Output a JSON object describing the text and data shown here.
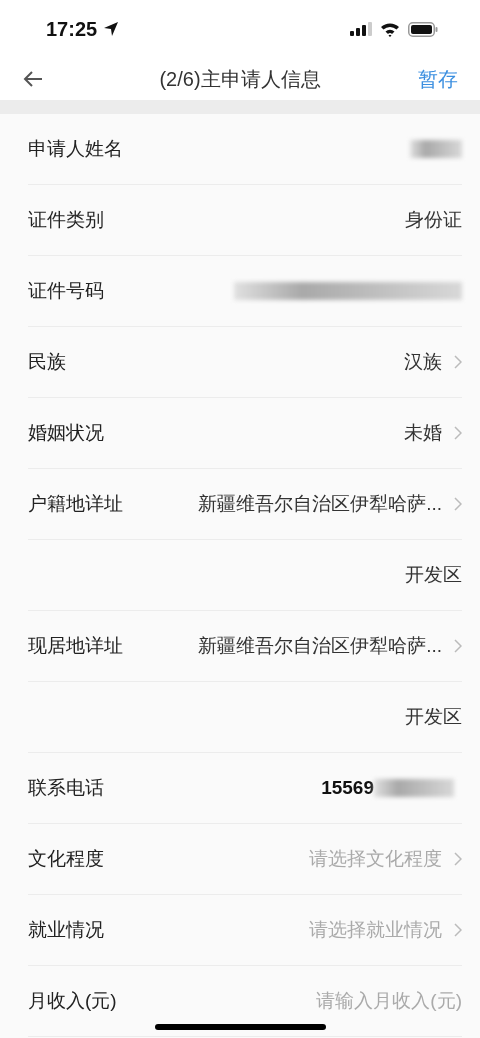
{
  "status_bar": {
    "time": "17:25"
  },
  "nav": {
    "title": "(2/6)主申请人信息",
    "action": "暂存"
  },
  "rows": [
    {
      "kind": "redacted",
      "label": "申请人姓名"
    },
    {
      "kind": "text",
      "label": "证件类别",
      "value": "身份证"
    },
    {
      "kind": "redacted_wide",
      "label": "证件号码"
    },
    {
      "kind": "select",
      "label": "民族",
      "value": "汉族"
    },
    {
      "kind": "select",
      "label": "婚姻状况",
      "value": "未婚"
    },
    {
      "kind": "select",
      "label": "户籍地详址",
      "value": "新疆维吾尔自治区伊犁哈萨..."
    },
    {
      "kind": "text",
      "value": "开发区"
    },
    {
      "kind": "select",
      "label": "现居地详址",
      "value": "新疆维吾尔自治区伊犁哈萨..."
    },
    {
      "kind": "text",
      "value": "开发区"
    },
    {
      "kind": "partial",
      "label": "联系电话",
      "value": "15569"
    },
    {
      "kind": "select",
      "label": "文化程度",
      "placeholder": "请选择文化程度"
    },
    {
      "kind": "select",
      "label": "就业情况",
      "placeholder": "请选择就业情况"
    },
    {
      "kind": "input",
      "label": "月收入(元)",
      "placeholder": "请输入月收入(元)"
    }
  ]
}
